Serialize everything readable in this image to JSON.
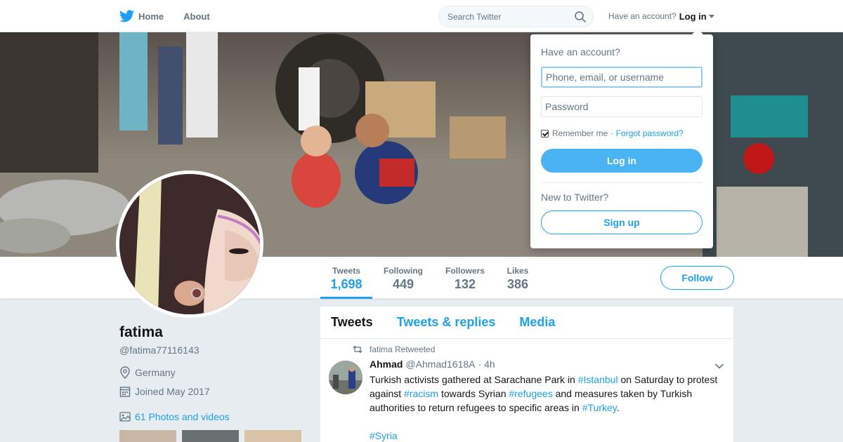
{
  "nav": {
    "home_label": "Home",
    "about_label": "About",
    "search_placeholder": "Search Twitter",
    "have_account": "Have an account?",
    "login_label": "Log in"
  },
  "profile": {
    "name": "fatima",
    "handle": "@fatima77116143",
    "location": "Germany",
    "joined": "Joined May 2017",
    "photos_link": "61 Photos and videos",
    "follow_label": "Follow",
    "stats": [
      {
        "label": "Tweets",
        "value": "1,698",
        "active": true
      },
      {
        "label": "Following",
        "value": "449"
      },
      {
        "label": "Followers",
        "value": "132"
      },
      {
        "label": "Likes",
        "value": "386"
      }
    ]
  },
  "timeline": {
    "tabs": [
      "Tweets",
      "Tweets & replies",
      "Media"
    ],
    "tweet": {
      "retweet_line": "fatima Retweeted",
      "fullname": "Ahmad",
      "screenname": "@Ahmad1618A",
      "time": "· 4h",
      "text_parts": [
        {
          "t": "Turkish activists gathered at Sarachane Park in "
        },
        {
          "t": "#Istanbul",
          "tag": true
        },
        {
          "t": " on Saturday to protest against "
        },
        {
          "t": "#racism",
          "tag": true
        },
        {
          "t": " towards Syrian "
        },
        {
          "t": "#refugees",
          "tag": true
        },
        {
          "t": " and measures taken by Turkish authorities to return refugees to specific areas in "
        },
        {
          "t": "#Turkey",
          "tag": true
        },
        {
          "t": "."
        }
      ],
      "last_tag": "#Syria"
    }
  },
  "login_dropdown": {
    "title": "Have an account?",
    "username_placeholder": "Phone, email, or username",
    "password_placeholder": "Password",
    "remember_label": "Remember me",
    "forgot_label": "· Forgot password?",
    "login_button": "Log in",
    "new_label": "New to Twitter?",
    "signup_button": "Sign up"
  },
  "colors": {
    "brand": "#1da1f2",
    "background": "#e6ecf0",
    "muted": "#657786"
  }
}
